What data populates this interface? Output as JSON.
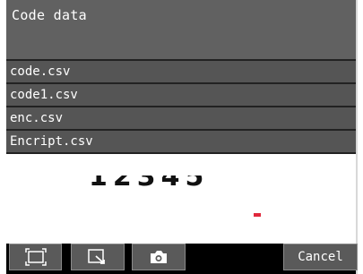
{
  "header": {
    "title": "Code data"
  },
  "file_list": {
    "items": [
      {
        "label": "code.csv"
      },
      {
        "label": "code1.csv"
      },
      {
        "label": "enc.csv"
      },
      {
        "label": "Encript.csv"
      }
    ]
  },
  "preview": {
    "digits": "12345"
  },
  "toolbar": {
    "buttons": [
      {
        "icon": "fit-to-screen-icon"
      },
      {
        "icon": "zoom-region-icon"
      },
      {
        "icon": "camera-icon"
      }
    ],
    "cancel_label": "Cancel"
  },
  "colors": {
    "header_bg": "#616161",
    "row_bg": "#555555",
    "marker": "#e0283c"
  }
}
